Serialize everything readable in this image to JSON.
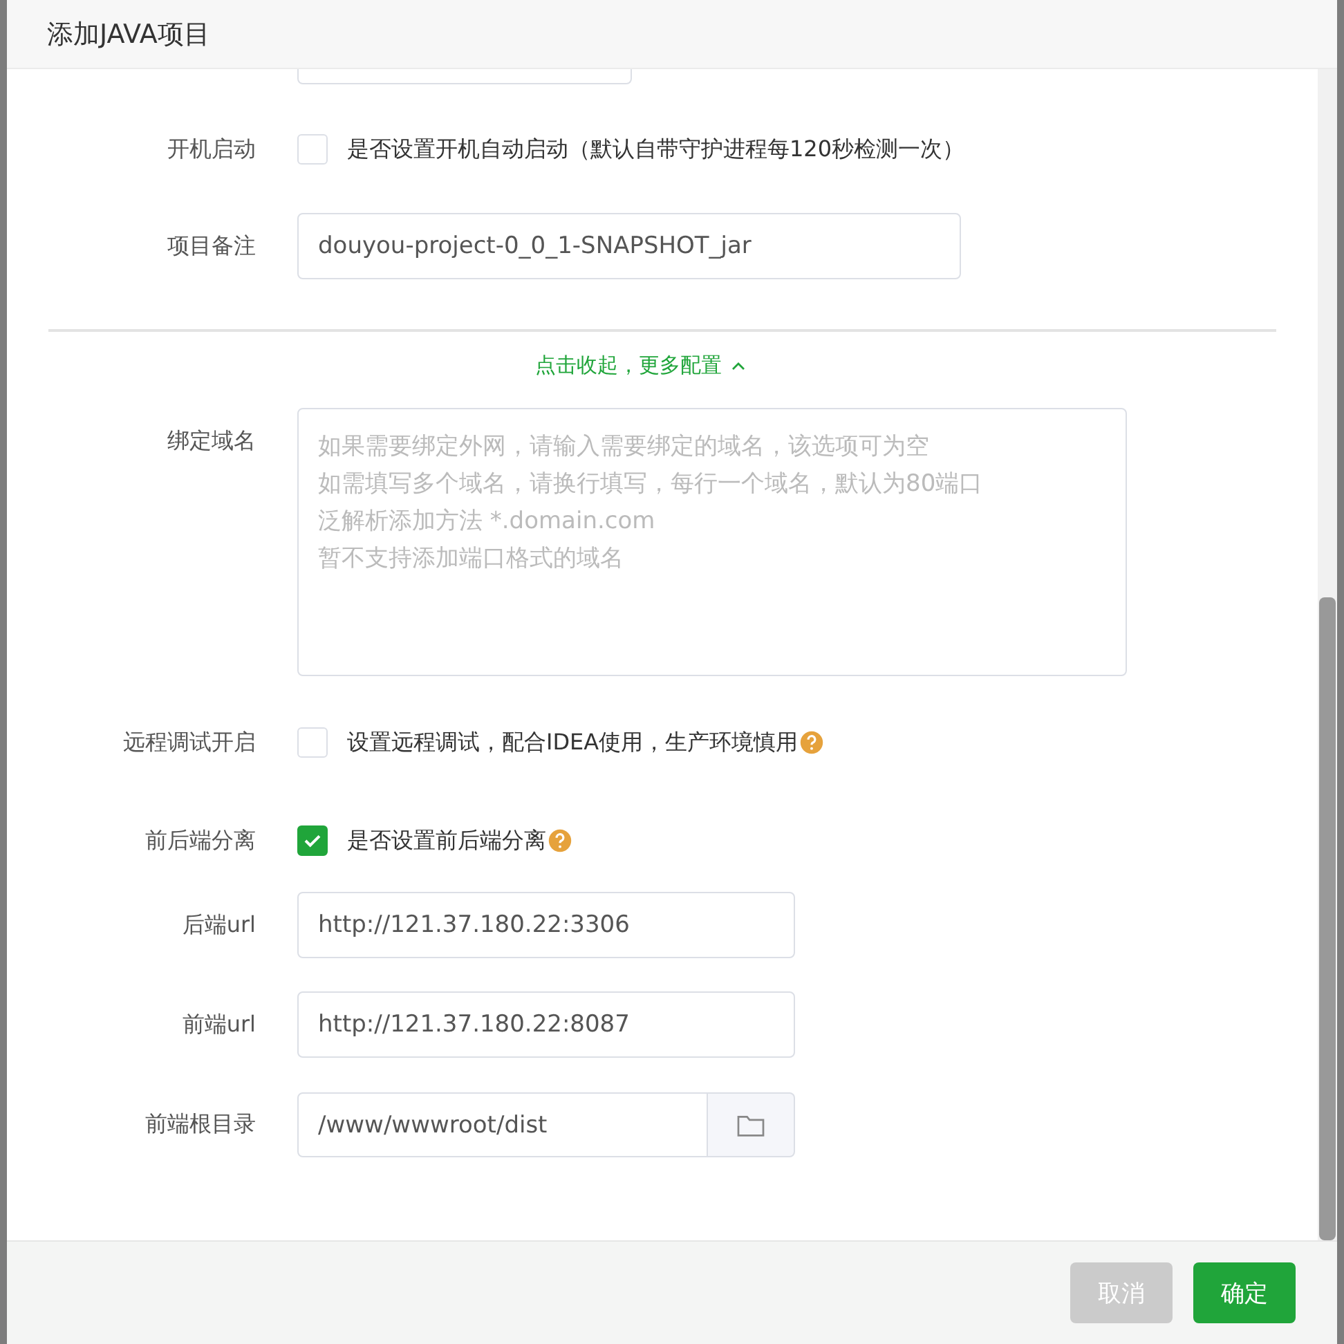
{
  "dialog": {
    "title": "添加JAVA项目"
  },
  "autostart": {
    "label": "开机启动",
    "checked": false,
    "text": "是否设置开机自动启动（默认自带守护进程每120秒检测一次）"
  },
  "remark": {
    "label": "项目备注",
    "value": "douyou-project-0_0_1-SNAPSHOT_jar"
  },
  "more_toggle": {
    "text": "点击收起，更多配置",
    "expanded": true
  },
  "domain": {
    "label": "绑定域名",
    "placeholder": [
      "如果需要绑定外网，请输入需要绑定的域名，该选项可为空",
      "如需填写多个域名，请换行填写，每行一个域名，默认为80端口",
      "泛解析添加方法 *.domain.com",
      "暂不支持添加端口格式的域名"
    ]
  },
  "remote_debug": {
    "label": "远程调试开启",
    "checked": false,
    "text": "设置远程调试，配合IDEA使用，生产环境慎用"
  },
  "separation": {
    "label": "前后端分离",
    "checked": true,
    "text": "是否设置前后端分离"
  },
  "backend_url": {
    "label": "后端url",
    "value": "http://121.37.180.22:3306"
  },
  "frontend_url": {
    "label": "前端url",
    "value": "http://121.37.180.22:8087"
  },
  "frontend_root": {
    "label": "前端根目录",
    "value": "/www/wwwroot/dist"
  },
  "buttons": [
    {
      "label": "取消",
      "kind": "cancel"
    },
    {
      "label": "确定",
      "kind": "confirm"
    }
  ]
}
